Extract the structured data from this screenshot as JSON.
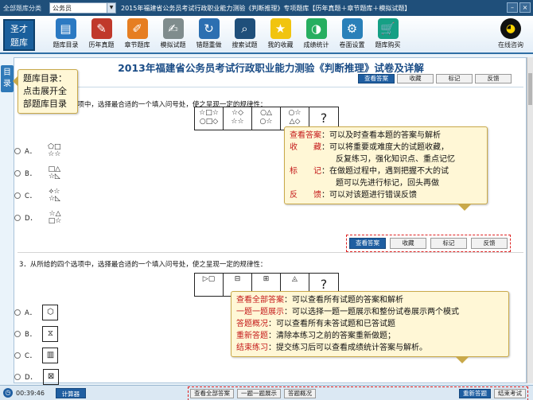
{
  "topbar": {
    "category_label": "全部题库分类",
    "selected_category": "公务员",
    "title": "2015年福建省公务员考试行政职业能力测验《判断推理》专项题库【历年真题＋章节题库＋模拟试题】",
    "win_minimize": "–",
    "win_close": "×"
  },
  "logo": {
    "line1": "圣才",
    "line2": "题库"
  },
  "toolbar": {
    "items": [
      {
        "label": "题库目录",
        "icon": "▤",
        "color": "#2b79c2"
      },
      {
        "label": "历年真题",
        "icon": "✎",
        "color": "#c0392b"
      },
      {
        "label": "章节题库",
        "icon": "✐",
        "color": "#e67e22"
      },
      {
        "label": "模拟试题",
        "icon": "✍",
        "color": "#7f8c8d"
      },
      {
        "label": "错题重做",
        "icon": "↻",
        "color": "#2c6fb1"
      },
      {
        "label": "搜索试题",
        "icon": "⌕",
        "color": "#1f4f7a"
      },
      {
        "label": "我的收藏",
        "icon": "★",
        "color": "#f1c40f"
      },
      {
        "label": "成绩统计",
        "icon": "◑",
        "color": "#27ae60"
      },
      {
        "label": "卷面设置",
        "icon": "⚙",
        "color": "#2980b9"
      },
      {
        "label": "题库购买",
        "icon": "🛒",
        "color": "#16a085"
      }
    ],
    "consult_label": "在线咨询"
  },
  "sidetab": {
    "label": "目录"
  },
  "page": {
    "title": "2013年福建省公务员考试行政职业能力测验《判断推理》试卷及详解",
    "top_buttons": [
      "查看答案",
      "收藏",
      "标记",
      "反馈"
    ]
  },
  "question2": {
    "text": "2．从所给的四个选项中，选择最合适的一个填入问号处，使之呈现一定的规律性：",
    "puzzle": [
      "☆□☆\n○□◇",
      "☆◇\n☆☆",
      "○△\n○☆",
      "○☆\n△◇",
      "?"
    ],
    "options": [
      {
        "letter": "A．",
        "shape": "⬠□\n☆☆"
      },
      {
        "letter": "B．",
        "shape": "□△\n☆◺"
      },
      {
        "letter": "C．",
        "shape": "⟡☆\n☆◺"
      },
      {
        "letter": "D．",
        "shape": "☆△\n□☆"
      }
    ],
    "buttons": [
      "查看答案",
      "收藏",
      "标记",
      "反馈"
    ]
  },
  "question3": {
    "text": "3．从所给的四个选项中，选择最合适的一个填入问号处，使之呈现一定的规律性：",
    "puzzle": [
      "▷▢",
      "⊟",
      "⊞",
      "◬",
      "?"
    ],
    "options": [
      {
        "letter": "A．",
        "shape": "⬡"
      },
      {
        "letter": "B．",
        "shape": "⧖"
      },
      {
        "letter": "C．",
        "shape": "▥"
      },
      {
        "letter": "D．",
        "shape": "⊠"
      }
    ]
  },
  "callout_dir": {
    "text": "题库目录：点击展开全部题库目录"
  },
  "callout_ans": {
    "lines": [
      {
        "key": "查看答案",
        "text": "：可以及时查看本题的答案与解析"
      },
      {
        "key": "收　　藏",
        "text": "：可以将重要或难度大的试题收藏，"
      },
      {
        "key": "",
        "text": "反复练习，强化知识点、重点记忆"
      },
      {
        "key": "标　　记",
        "text": "：在做题过程中，遇到把握不大的试"
      },
      {
        "key": "",
        "text": "题可以先进行标记，回头再做"
      },
      {
        "key": "反　　馈",
        "text": "：可以对该题进行错误反馈"
      }
    ]
  },
  "callout_all": {
    "lines": [
      {
        "key": "查看全部答案",
        "text": "：可以查看所有试题的答案和解析"
      },
      {
        "key": "一题一题展示",
        "text": "：可以选择一题一题展示和整份试卷展示两个模式"
      },
      {
        "key": "答题概况",
        "text": "：可以查看所有未答试题和已答试题"
      },
      {
        "key": "重新答题",
        "text": "：清除本练习之前的答案重新做题；"
      },
      {
        "key": "结束练习",
        "text": "：提交练习后可以查看成绩统计答案与解析。"
      }
    ]
  },
  "bottombar": {
    "timer": "00:39:46",
    "calculator": "计算器",
    "buttons": [
      "查看全部答案",
      "一题一题展示",
      "答题概况"
    ],
    "right_buttons": [
      "重新答题",
      "结束考试"
    ]
  }
}
